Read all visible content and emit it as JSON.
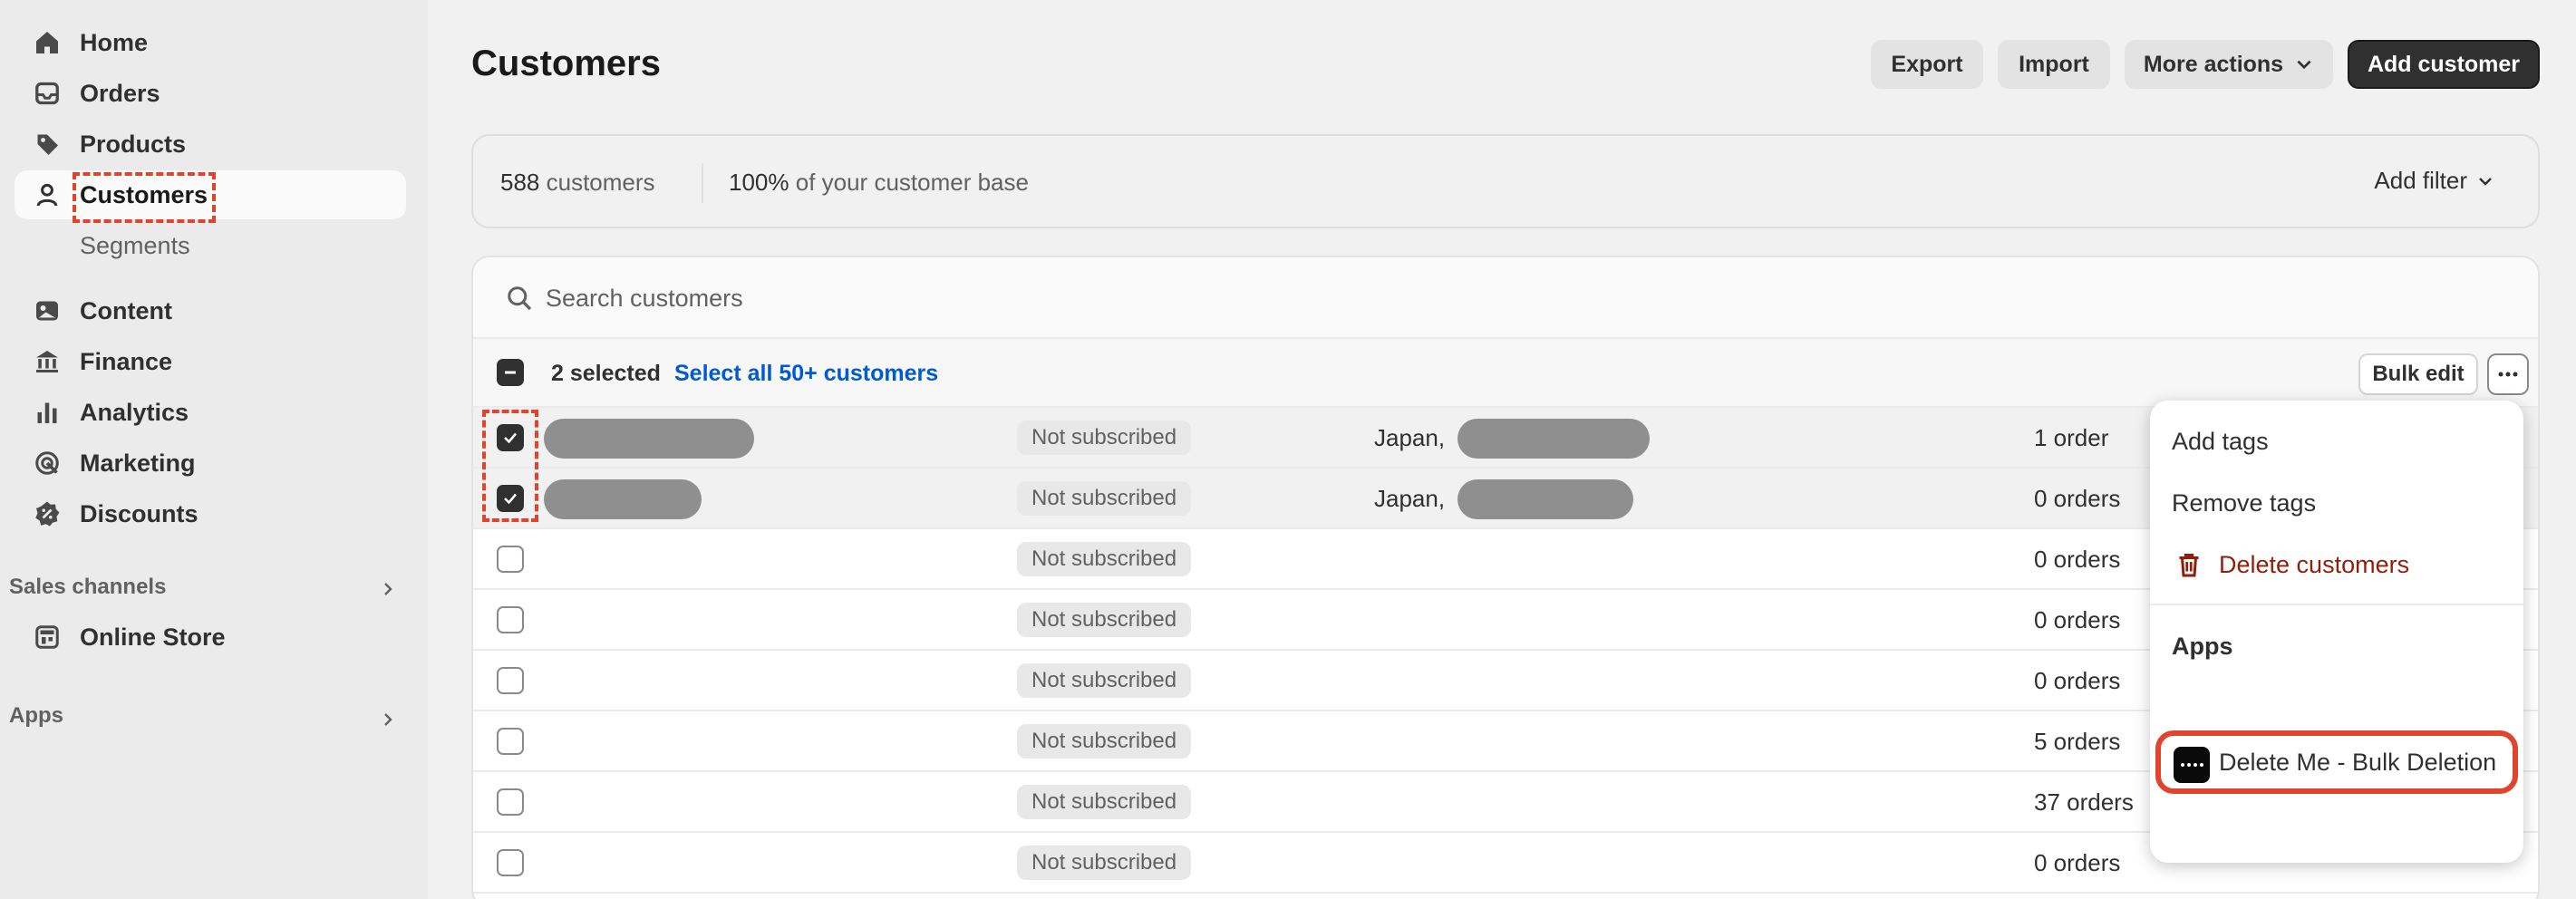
{
  "sidebar": {
    "items": [
      {
        "label": "Home",
        "icon": "home-icon"
      },
      {
        "label": "Orders",
        "icon": "inbox-icon"
      },
      {
        "label": "Products",
        "icon": "tag-icon"
      },
      {
        "label": "Customers",
        "icon": "person-icon"
      },
      {
        "label": "Segments",
        "icon": ""
      },
      {
        "label": "Content",
        "icon": "image-icon"
      },
      {
        "label": "Finance",
        "icon": "bank-icon"
      },
      {
        "label": "Analytics",
        "icon": "bar-chart-icon"
      },
      {
        "label": "Marketing",
        "icon": "target-icon"
      },
      {
        "label": "Discounts",
        "icon": "discount-icon"
      }
    ],
    "sales_channels": "Sales channels",
    "online_store": "Online Store",
    "apps": "Apps"
  },
  "header": {
    "title": "Customers",
    "export": "Export",
    "import": "Import",
    "more_actions": "More actions",
    "add_customer": "Add customer"
  },
  "stats": {
    "count": "588",
    "count_label": "customers",
    "percent": "100%",
    "percent_label": "of your customer base",
    "add_filter": "Add filter"
  },
  "search": {
    "placeholder": "Search customers"
  },
  "bulk": {
    "selected": "2 selected",
    "select_all": "Select all 50+ customers",
    "bulk_edit": "Bulk edit"
  },
  "rows": [
    {
      "subscription": "Not subscribed",
      "location": "Japan, ",
      "orders": "1 order"
    },
    {
      "subscription": "Not subscribed",
      "location": "Japan, ",
      "orders": "0 orders"
    },
    {
      "subscription": "Not subscribed",
      "location": "",
      "orders": "0 orders"
    },
    {
      "subscription": "Not subscribed",
      "location": "",
      "orders": "0 orders"
    },
    {
      "subscription": "Not subscribed",
      "location": "",
      "orders": "0 orders"
    },
    {
      "subscription": "Not subscribed",
      "location": "",
      "orders": "5 orders"
    },
    {
      "subscription": "Not subscribed",
      "location": "",
      "orders": "37 orders"
    },
    {
      "subscription": "Not subscribed",
      "location": "",
      "orders": "0 orders"
    }
  ],
  "menu": {
    "add_tags": "Add tags",
    "remove_tags": "Remove tags",
    "delete_customers": "Delete customers",
    "apps_heading": "Apps",
    "app_item": "Delete Me - Bulk Deletion"
  },
  "colors": {
    "accent_link": "#005bd3",
    "annotation": "#e0442c",
    "danger": "#8e1f0b"
  }
}
